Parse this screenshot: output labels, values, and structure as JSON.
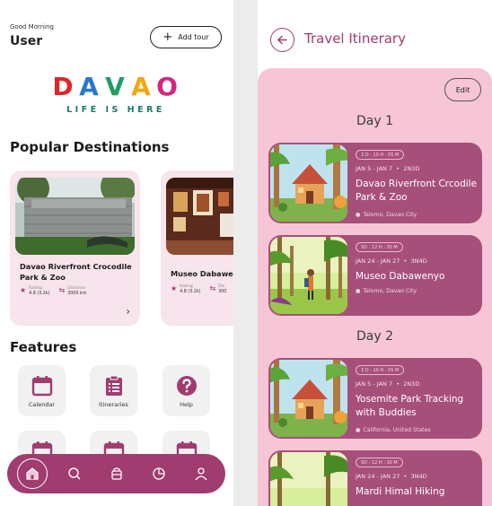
{
  "home": {
    "greeting": "Good Morning",
    "user_name": "User",
    "add_tour_label": "Add tour",
    "logo": {
      "letters": [
        "D",
        "A",
        "V",
        "A",
        "O"
      ],
      "tagline": "LIFE IS HERE"
    },
    "popular_title": "Popular Destinations",
    "destinations": [
      {
        "name": "Davao Riverfront Crocodile Park & Zoo",
        "rating_label": "Rating",
        "rating": "4.8 (3.2k)",
        "distance_label": "Distance",
        "distance": "3000 km"
      },
      {
        "name": "Museo Dabawen",
        "rating_label": "Rating",
        "rating": "4.8 (3.2k)",
        "distance_label": "Dis",
        "distance": "300"
      }
    ],
    "features_title": "Features",
    "features": [
      {
        "label": "Calendar",
        "icon": "calendar-icon"
      },
      {
        "label": "Itineraries",
        "icon": "clipboard-icon"
      },
      {
        "label": "Help",
        "icon": "help-icon"
      },
      {
        "label": "",
        "icon": "calendar-icon"
      },
      {
        "label": "",
        "icon": "calendar-icon"
      },
      {
        "label": "",
        "icon": "calendar-icon"
      }
    ],
    "nav": [
      "home-icon",
      "search-icon",
      "basket-icon",
      "pie-chart-icon",
      "profile-icon"
    ]
  },
  "itinerary": {
    "title": "Travel Itinerary",
    "edit_label": "Edit",
    "days": [
      {
        "label": "Day 1",
        "items": [
          {
            "badge": "3 D : 10 H : 05 M",
            "dates": "JAN 5 - JAN 7",
            "duration": "2N3D",
            "name": "Davao Riverfront Crcodile Park & Zoo",
            "location": "Talomo, Davao City"
          },
          {
            "badge": "5D : 12 H : 30 M",
            "dates": "JAN 24 - JAN 27",
            "duration": "3N4D",
            "name": "Museo Dabawenyo",
            "location": "Talomo, Davao City"
          }
        ]
      },
      {
        "label": "Day 2",
        "items": [
          {
            "badge": "3 D : 10 H : 05 M",
            "dates": "JAN 5 - JAN 7",
            "duration": "2N3D",
            "name": "Yosemite Park Tracking with Buddies",
            "location": "California, United States"
          },
          {
            "badge": "5D : 12 H : 30 M",
            "dates": "JAN 24 - JAN 27",
            "duration": "3N4D",
            "name": "Mardi Himal Hiking",
            "location": ""
          }
        ]
      }
    ]
  },
  "colors": {
    "accent": "#a03c70",
    "panel": "#f7c6d6",
    "card": "#a74f7b",
    "destination_card": "#f8e4ec"
  }
}
